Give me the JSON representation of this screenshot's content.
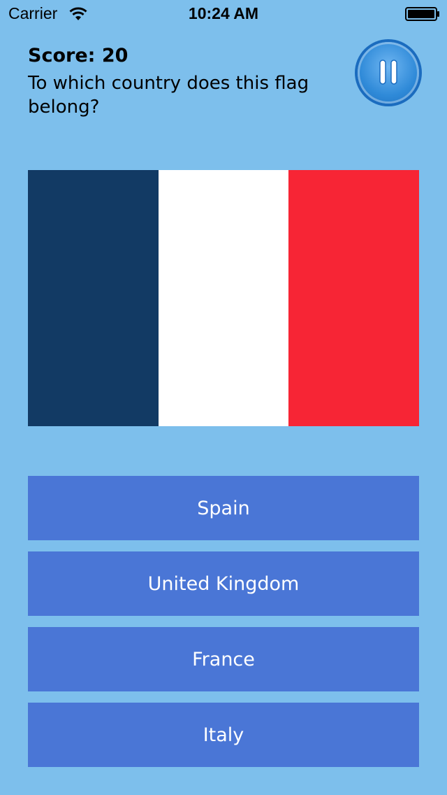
{
  "status_bar": {
    "carrier": "Carrier",
    "time": "10:24 AM",
    "wifi_icon": "wifi-icon",
    "battery_icon": "battery-icon"
  },
  "header": {
    "score": "Score: 20",
    "question": "To which country does this flag belong?",
    "pause_icon": "pause-icon"
  },
  "flag": {
    "stripes": [
      "#123a64",
      "#ffffff",
      "#f72535"
    ]
  },
  "answers": [
    {
      "label": "Spain"
    },
    {
      "label": "United Kingdom"
    },
    {
      "label": "France"
    },
    {
      "label": "Italy"
    }
  ],
  "colors": {
    "background": "#7dbfec",
    "button": "#4a76d6",
    "pause_button": "#2f8ad8"
  }
}
